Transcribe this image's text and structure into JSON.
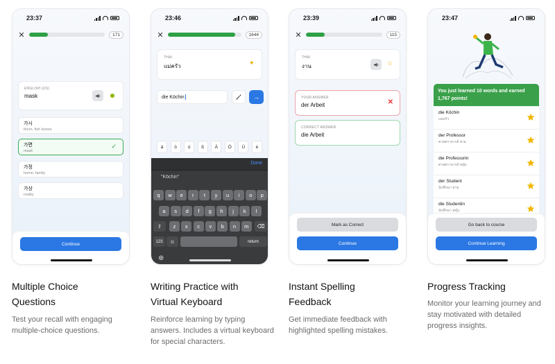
{
  "phones": [
    {
      "time": "23:37",
      "progress": 0.25,
      "score": "171",
      "prompt": {
        "language": "ENGLISH (US)",
        "word": "mask"
      },
      "options": [
        {
          "word": "가시",
          "sub": "thorn, fish bones"
        },
        {
          "word": "가면",
          "sub": "mask"
        },
        {
          "word": "가정",
          "sub": "home, family"
        },
        {
          "word": "가상",
          "sub": "reality"
        }
      ],
      "continue_label": "Continue"
    },
    {
      "time": "23:46",
      "progress": 0.92,
      "score": "1644",
      "prompt": {
        "language": "THAI",
        "word": "แม่ครัว"
      },
      "answer_value": "die Köchin",
      "special_chars": [
        "ä",
        "ö",
        "ü",
        "ß",
        "Ä",
        "Ö",
        "Ü",
        "é"
      ],
      "keyboard": {
        "suggestion": "\"Köchin\"",
        "done_label": "Done",
        "row1": [
          "q",
          "w",
          "e",
          "r",
          "t",
          "y",
          "u",
          "i",
          "o",
          "p"
        ],
        "row2": [
          "a",
          "s",
          "d",
          "f",
          "g",
          "h",
          "j",
          "k",
          "l"
        ],
        "row3": [
          "z",
          "x",
          "c",
          "v",
          "b",
          "n",
          "m"
        ],
        "numbers_label": "123",
        "return_label": "return"
      }
    },
    {
      "time": "23:39",
      "progress": 0.25,
      "score": "115",
      "prompt": {
        "language": "THAI",
        "word": "งาน"
      },
      "your_answer": {
        "label": "YOUR ANSWER",
        "value": "der Arbeit"
      },
      "correct_answer": {
        "label": "CORRECT ANSWER",
        "value": "die Arbeit"
      },
      "mark_correct_label": "Mark as Correct",
      "continue_label": "Continue"
    },
    {
      "time": "23:47",
      "banner": "You just learned 10 words and earned 1,767 points!",
      "words": [
        {
          "word": "die Köchin",
          "sub": "แม่ครัว"
        },
        {
          "word": "der Professor",
          "sub": "ศาสตราจารย์ ชาย"
        },
        {
          "word": "die Professorin",
          "sub": "ศาสตราจารย์ หญิง"
        },
        {
          "word": "der Student",
          "sub": "นักศึกษา ชาย"
        },
        {
          "word": "die Studentin",
          "sub": "นักศึกษา หญิง"
        }
      ],
      "back_label": "Go back to course",
      "continue_label": "Continue Learning"
    }
  ],
  "captions": [
    {
      "title_line1": "Multiple Choice",
      "title_line2": "Questions",
      "text": "Test your recall with engaging multiple-choice questions."
    },
    {
      "title_line1": "Writing Practice with",
      "title_line2": "Virtual Keyboard",
      "text": "Reinforce learning by typing answers. Includes a virtual keyboard for special characters."
    },
    {
      "title_line1": "Instant Spelling",
      "title_line2": "Feedback",
      "text": "Get immediate feedback with highlighted spelling mistakes."
    },
    {
      "title_line1": "Progress Tracking",
      "title_line2": "",
      "text": "Monitor your learning journey and stay motivated with detailed progress insights."
    }
  ],
  "colors": {
    "accent_blue": "#2b78e4",
    "success_green": "#2ea046",
    "error_red": "#e0353b",
    "star_gold": "#f2b705"
  }
}
